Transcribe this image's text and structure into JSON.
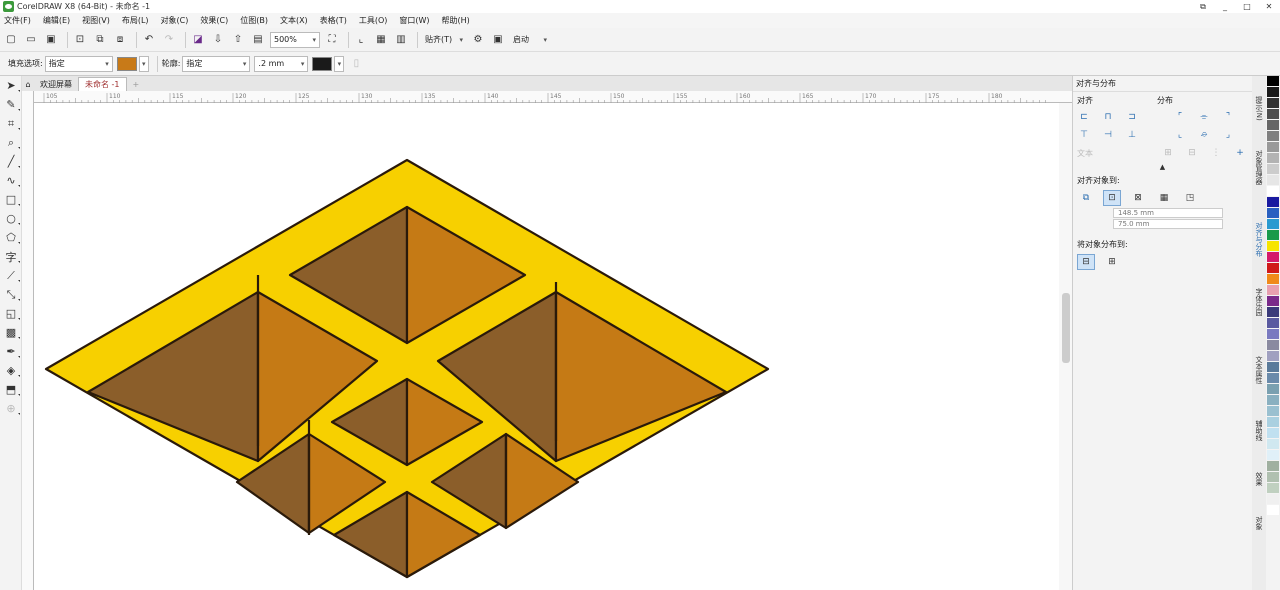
{
  "window": {
    "title": "CorelDRAW X8 (64-Bit) - 未命名 -1",
    "controls": [
      "⧉",
      "_",
      "□",
      "✕"
    ]
  },
  "menu": [
    "文件(F)",
    "编辑(E)",
    "视图(V)",
    "布局(L)",
    "对象(C)",
    "效果(C)",
    "位图(B)",
    "文本(X)",
    "表格(T)",
    "工具(O)",
    "窗口(W)",
    "帮助(H)"
  ],
  "toolbar": {
    "zoom": "500%",
    "snap_label": "贴齐(T)",
    "launch_label": "启动"
  },
  "property_bar": {
    "fill_label": "填充选项:",
    "fill_value": "指定",
    "fill_color": "#c87a18",
    "outline_label": "轮廓:",
    "outline_value": "指定",
    "outline_width": ".2 mm",
    "outline_color": "#1a1a1a"
  },
  "doc_tabs": [
    "欢迎屏幕",
    "未命名 -1"
  ],
  "ruler": {
    "labels": [
      "105",
      "110",
      "115",
      "120",
      "125",
      "130",
      "135",
      "140",
      "145",
      "150",
      "155",
      "160",
      "165",
      "170",
      "175",
      "180"
    ]
  },
  "artwork": {
    "colors": {
      "frame": "#f7d000",
      "face_dark": "#8b5e2a",
      "face_light": "#c57a15",
      "outline": "#2a1a0a"
    }
  },
  "panel": {
    "title": "对齐与分布",
    "align_label": "对齐",
    "distribute_label": "分布",
    "text_label": "文本",
    "align_to_label": "对齐对象到:",
    "x_value": "148.5 mm",
    "y_value": "75.0 mm",
    "distribute_to_label": "将对象分布到:"
  },
  "side_tabs": [
    "提示(N)",
    "对象管理器",
    "对齐与分布",
    "字体乐园",
    "文本属性",
    "辅助线",
    "效果",
    "对象"
  ],
  "palette": [
    "#000000",
    "#1a1a1a",
    "#333333",
    "#4d4d4d",
    "#666666",
    "#808080",
    "#999999",
    "#b3b3b3",
    "#cccccc",
    "#e6e6e6",
    "#ffffff",
    "#1a1aa0",
    "#2a60c0",
    "#2a9ad0",
    "#1a9a4a",
    "#f7e400",
    "#d41a6a",
    "#d01a1a",
    "#f08a1a",
    "#e8a0b0",
    "#7a2a8a",
    "#3a3a7a",
    "#5a5aa0",
    "#7a7ac0",
    "#8a8aa0",
    "#a0a0c0",
    "#5a7a9a",
    "#6a8aaa",
    "#7aa0b0",
    "#8ab0c0",
    "#9ac0d0",
    "#aad0e0",
    "#c0e0f0",
    "#d0e8f0",
    "#e0f0f8",
    "#a0b0a0",
    "#b0c0b0",
    "#c0d0c0",
    "#f0f0f0",
    "#ffffff"
  ]
}
